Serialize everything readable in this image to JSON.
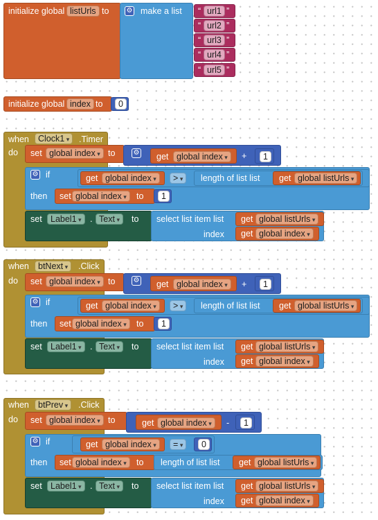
{
  "init_list": {
    "keyword": "initialize global",
    "var": "listUrls",
    "to": "to",
    "make_list": "make a list",
    "quote": "“",
    "quote_close": "”",
    "items": [
      "url1",
      "url2",
      "url3",
      "url4",
      "url5"
    ]
  },
  "init_index": {
    "keyword": "initialize global",
    "var": "index",
    "to": "to",
    "value": "0"
  },
  "events": [
    {
      "when": "when",
      "component": "Clock1",
      "event": ".Timer",
      "do": "do",
      "set": "set",
      "set_var": "global index",
      "to": "to",
      "get": "get",
      "get_var": "global index",
      "op": "+",
      "num": "1",
      "if": "if",
      "then": "then",
      "if_get_var": "global index",
      "compare": ">",
      "length_of": "length of list  list",
      "list_var": "global listUrls",
      "then_set_var": "global index",
      "then_value": "1",
      "label_set": "set",
      "label": "Label1",
      "dot": ".",
      "prop": "Text",
      "select": "select list item  list",
      "index_label": "index",
      "sel_list_var": "global listUrls",
      "sel_index_var": "global index"
    },
    {
      "when": "when",
      "component": "btNext",
      "event": ".Click",
      "do": "do",
      "set": "set",
      "set_var": "global index",
      "to": "to",
      "get": "get",
      "get_var": "global index",
      "op": "+",
      "num": "1",
      "if": "if",
      "then": "then",
      "if_get_var": "global index",
      "compare": ">",
      "length_of": "length of list  list",
      "list_var": "global listUrls",
      "then_set_var": "global index",
      "then_value": "1",
      "label_set": "set",
      "label": "Label1",
      "dot": ".",
      "prop": "Text",
      "select": "select list item  list",
      "index_label": "index",
      "sel_list_var": "global listUrls",
      "sel_index_var": "global index"
    },
    {
      "when": "when",
      "component": "btPrev",
      "event": ".Click",
      "do": "do",
      "set": "set",
      "set_var": "global index",
      "to": "to",
      "get": "get",
      "get_var": "global index",
      "op": "-",
      "num": "1",
      "if": "if",
      "then": "then",
      "if_get_var": "global index",
      "compare": "=",
      "compare_value": "0",
      "then_set_var": "global index",
      "then_length_of": "length of list  list",
      "then_list_var": "global listUrls",
      "label_set": "set",
      "label": "Label1",
      "dot": ".",
      "prop": "Text",
      "select": "select list item  list",
      "index_label": "index",
      "sel_list_var": "global listUrls",
      "sel_index_var": "global index"
    }
  ],
  "colors": {
    "variables": "#d05f2d",
    "lists": "#4a9ad4",
    "math": "#3f62b8",
    "text": "#ab2d5e",
    "event": "#b09133",
    "component": "#245c45"
  }
}
